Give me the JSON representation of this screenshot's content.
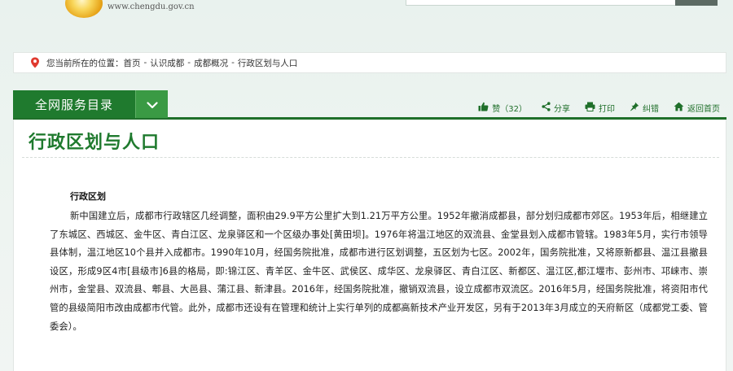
{
  "header": {
    "site_url": "www.chengdu.gov.cn"
  },
  "breadcrumb": {
    "prefix": "您当前所在的位置：",
    "items": [
      "首页",
      "认识成都",
      "成都概况",
      "行政区划与人口"
    ],
    "separator": "-"
  },
  "catalog": {
    "label": "全网服务目录"
  },
  "tools": {
    "like_label": "赞（32）",
    "share_label": "分享",
    "print_label": "打印",
    "correct_label": "纠错",
    "home_label": "返回首页"
  },
  "article": {
    "title": "行政区划与人口",
    "heading": "行政区划",
    "body": "新中国建立后，成都市行政辖区几经调整，面积由29.9平方公里扩大到1.21万平方公里。1952年撤消成都县，部分划归成都市郊区。1953年后，相继建立了东城区、西城区、金牛区、青白江区、龙泉驿区和一个区级办事处[黄田坝]。1976年将温江地区的双流县、金堂县划入成都市管辖。1983年5月，实行市领导县体制，温江地区10个县并入成都市。1990年10月，经国务院批准，成都市进行区划调整，五区划为七区。2002年，国务院批准，又将原新都县、温江县撤县设区，形成9区4市[县级市]6县的格局，即:锦江区、青羊区、金牛区、武侯区、成华区、龙泉驿区、青白江区、新都区、温江区,都江堰市、彭州市、邛崃市、崇州市，金堂县、双流县、郫县、大邑县、蒲江县、新津县。2016年，经国务院批准，撤销双流县，设立成都市双流区。2016年5月，经国务院批准，将资阳市代管的县级简阳市改由成都市代管。此外，成都市还设有在管理和统计上实行单列的成都高新技术产业开发区，另有于2013年3月成立的天府新区（成都党工委、管委会）。"
  },
  "colors": {
    "brand_green": "#1f7a2e",
    "toggle_green": "#3a9a44",
    "pin_red": "#e03a2f"
  }
}
